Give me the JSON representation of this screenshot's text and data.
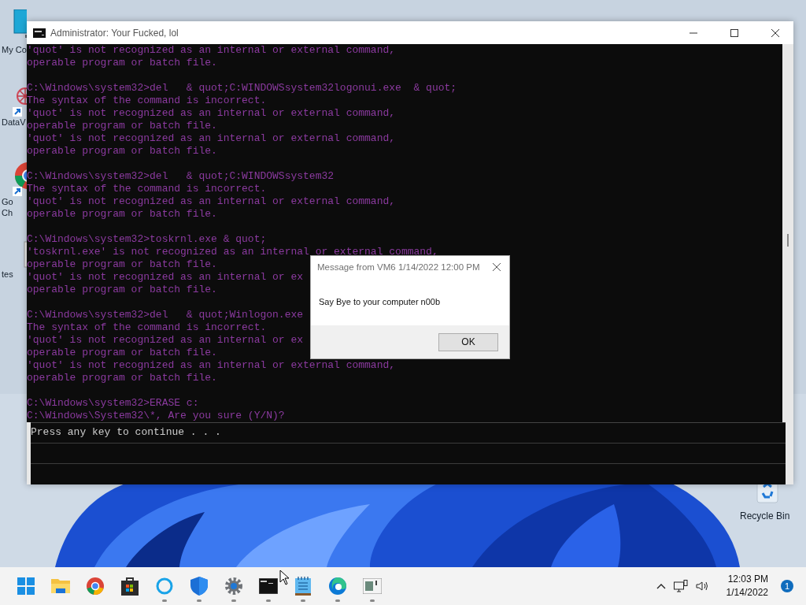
{
  "desktop_icons": [
    {
      "kind": "monitor",
      "lines": [
        "My Co"
      ]
    },
    {
      "kind": "network",
      "lines": [
        "DataV"
      ]
    },
    {
      "kind": "chrome",
      "lines": [
        "Go",
        "Ch"
      ]
    },
    {
      "kind": "file",
      "lines": [
        "tes"
      ]
    },
    {
      "kind": "recycle",
      "lines": [
        "Recycle Bin"
      ]
    }
  ],
  "console_window": {
    "title": "Administrator:  Your Fucked, lol",
    "blocks": [
      [
        "'quot' is not recognized as an internal or external command,",
        "operable program or batch file."
      ],
      [
        "C:\\Windows\\system32>del   & quot;C:WINDOWSsystem32logonui.exe  & quot;",
        "The syntax of the command is incorrect.",
        "'quot' is not recognized as an internal or external command,",
        "operable program or batch file.",
        "'quot' is not recognized as an internal or external command,",
        "operable program or batch file."
      ],
      [
        "C:\\Windows\\system32>del   & quot;C:WINDOWSsystem32",
        "The syntax of the command is incorrect.",
        "'quot' is not recognized as an internal or external command,",
        "operable program or batch file."
      ],
      [
        "C:\\Windows\\system32>toskrnl.exe & quot;",
        "'toskrnl.exe' is not recognized as an internal or external command,",
        "operable program or batch file.",
        "'quot' is not recognized as an internal or ex",
        "operable program or batch file."
      ],
      [
        "C:\\Windows\\system32>del   & quot;Winlogon.exe",
        "The syntax of the command is incorrect.",
        "'quot' is not recognized as an internal or ex",
        "operable program or batch file.",
        "'quot' is not recognized as an internal or external command,",
        "operable program or batch file."
      ],
      [
        "C:\\Windows\\system32>ERASE c:",
        "C:\\Windows\\System32\\*, Are you sure (Y/N)?"
      ]
    ],
    "overlay_line": "Press any key to continue . . ."
  },
  "message_box": {
    "title": "Message from VM6 1/14/2022 12:00 PM",
    "message": "Say Bye to your computer n00b",
    "button": "OK"
  },
  "taskbar": {
    "apps": [
      {
        "kind": "start",
        "running": false
      },
      {
        "kind": "folder",
        "running": false
      },
      {
        "kind": "chrome",
        "running": false
      },
      {
        "kind": "store",
        "running": false
      },
      {
        "kind": "circle",
        "running": true
      },
      {
        "kind": "shield",
        "running": true
      },
      {
        "kind": "gear",
        "running": true
      },
      {
        "kind": "terminal",
        "running": true
      },
      {
        "kind": "notepad",
        "running": true
      },
      {
        "kind": "edge",
        "running": true
      },
      {
        "kind": "window",
        "running": true
      }
    ],
    "time": "12:03 PM",
    "date": "1/14/2022",
    "notification_count": "1"
  }
}
